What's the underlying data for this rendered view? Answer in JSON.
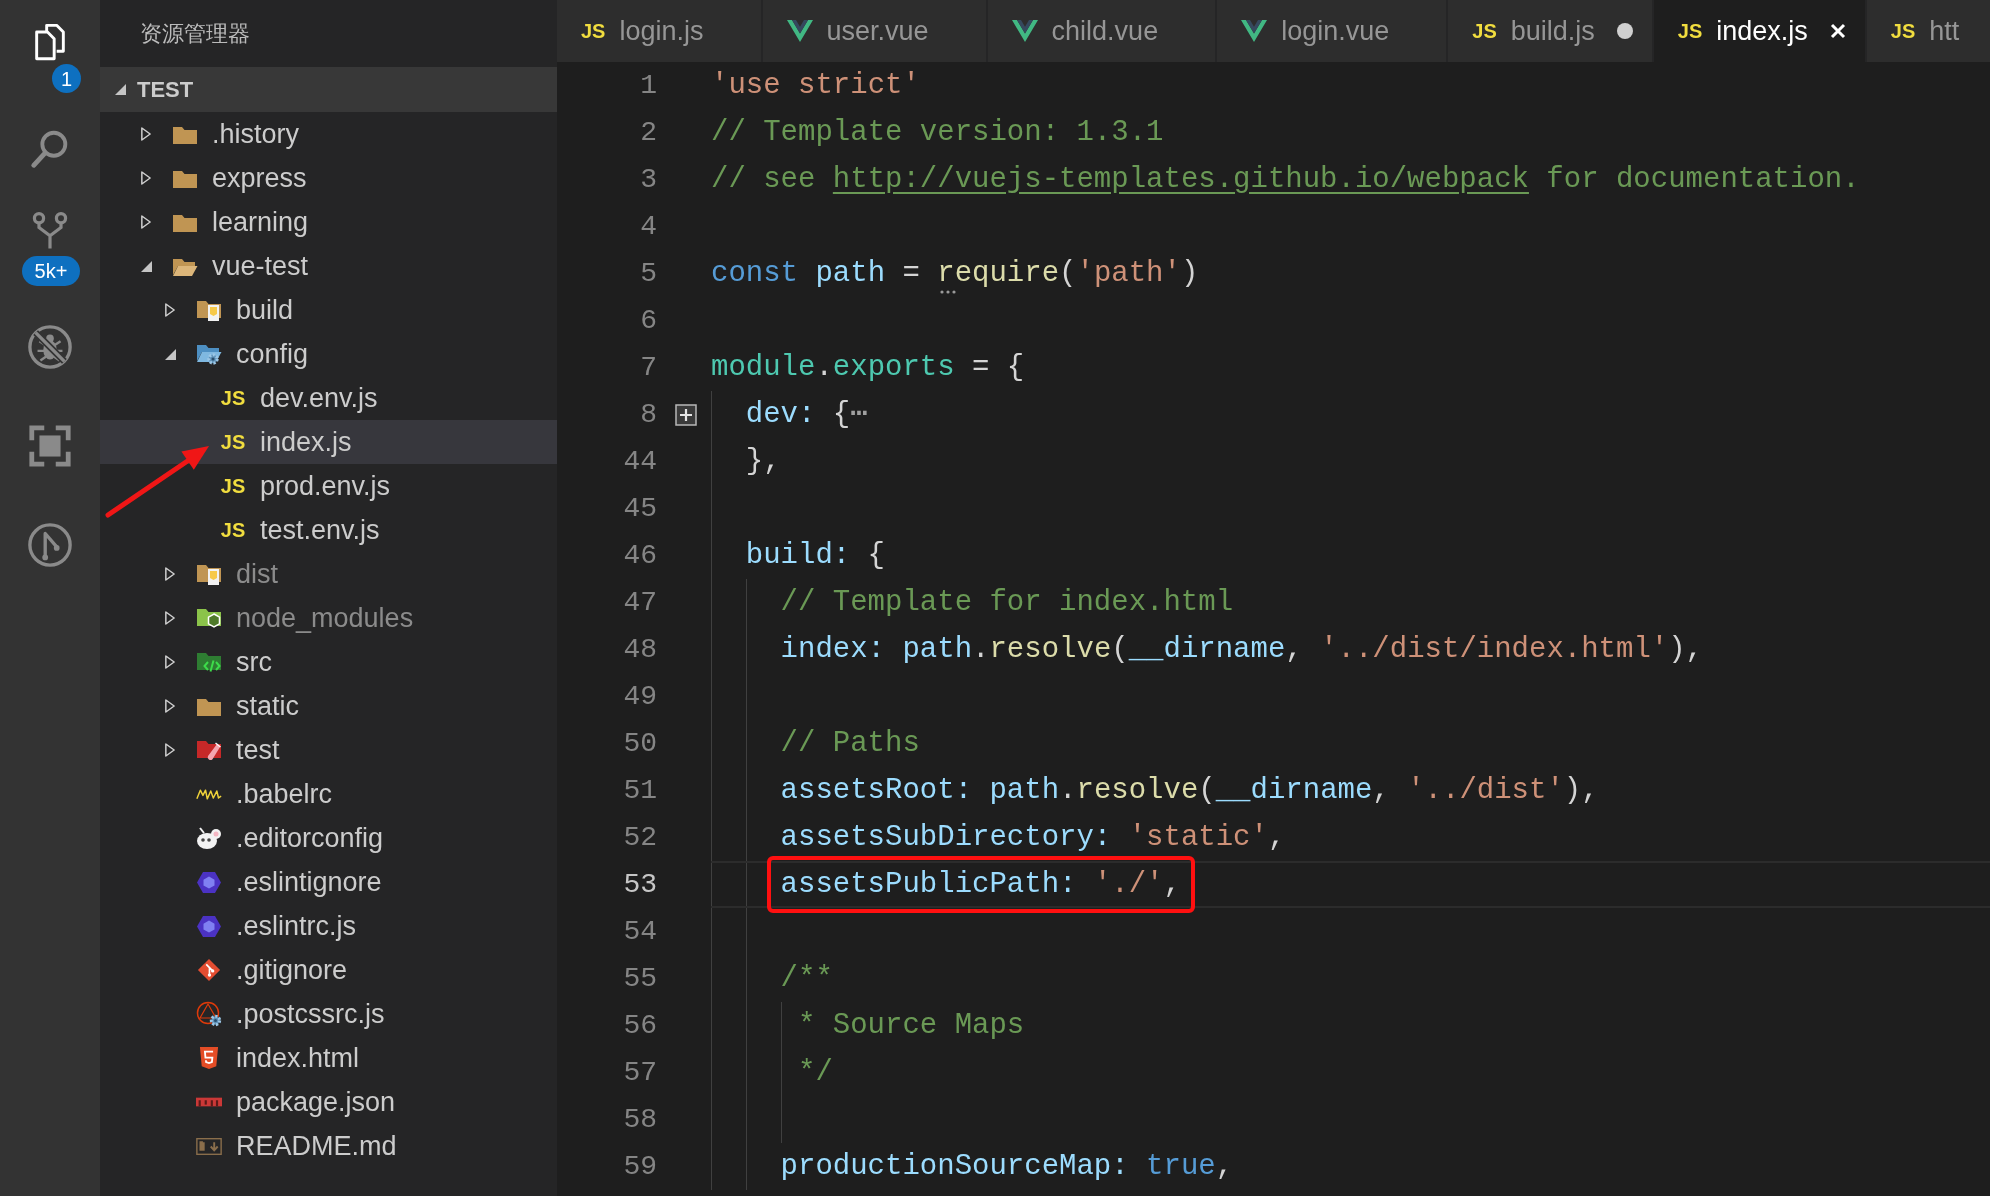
{
  "activity_bar": [
    {
      "kind": "files",
      "selected": true,
      "badge": "1"
    },
    {
      "kind": "search",
      "selected": false
    },
    {
      "kind": "scm",
      "selected": false,
      "badge": "5k+"
    },
    {
      "kind": "debug",
      "selected": false
    },
    {
      "kind": "extensions",
      "selected": false
    },
    {
      "kind": "history",
      "selected": false
    }
  ],
  "sidebar": {
    "title": "资源管理器",
    "section": {
      "label": "TEST",
      "expanded": true
    },
    "tree": [
      {
        "label": ".history",
        "kind": "folder",
        "expanded": false,
        "selected": false,
        "dimmed": false,
        "marked": false
      },
      {
        "label": "express",
        "kind": "folder",
        "expanded": false,
        "selected": false,
        "dimmed": false,
        "marked": false
      },
      {
        "label": "learning",
        "kind": "folder",
        "expanded": false,
        "selected": false,
        "dimmed": false,
        "marked": false
      },
      {
        "label": "vue-test",
        "kind": "folder",
        "expanded": true,
        "selected": false,
        "dimmed": false,
        "marked": false,
        "children": [
          {
            "label": "build",
            "kind": "buildfolder",
            "expanded": false,
            "selected": false,
            "dimmed": false,
            "marked": false
          },
          {
            "label": "config",
            "kind": "configfolder",
            "expanded": true,
            "selected": false,
            "dimmed": false,
            "marked": false,
            "children": [
              {
                "label": "dev.env.js",
                "kind": "js",
                "glyph": "JS",
                "selected": false,
                "dimmed": false,
                "marked": false
              },
              {
                "label": "index.js",
                "kind": "js",
                "glyph": "JS",
                "selected": true,
                "dimmed": false,
                "marked": true
              },
              {
                "label": "prod.env.js",
                "kind": "js",
                "glyph": "JS",
                "selected": false,
                "dimmed": false,
                "marked": false
              },
              {
                "label": "test.env.js",
                "kind": "js",
                "glyph": "JS",
                "selected": false,
                "dimmed": false,
                "marked": false
              }
            ]
          },
          {
            "label": "dist",
            "kind": "buildfolder",
            "expanded": false,
            "selected": false,
            "dimmed": true,
            "marked": false
          },
          {
            "label": "node_modules",
            "kind": "nodefolder",
            "expanded": false,
            "selected": false,
            "dimmed": true,
            "marked": false
          },
          {
            "label": "src",
            "kind": "srcfolder",
            "expanded": false,
            "selected": false,
            "dimmed": false,
            "marked": false
          },
          {
            "label": "static",
            "kind": "folder",
            "expanded": false,
            "selected": false,
            "dimmed": false,
            "marked": false
          },
          {
            "label": "test",
            "kind": "testfolder",
            "expanded": false,
            "selected": false,
            "dimmed": false,
            "marked": false
          },
          {
            "label": ".babelrc",
            "kind": "babel",
            "selected": false,
            "dimmed": false,
            "marked": false
          },
          {
            "label": ".editorconfig",
            "kind": "editorconfig",
            "selected": false,
            "dimmed": false,
            "marked": false
          },
          {
            "label": ".eslintignore",
            "kind": "eslint",
            "selected": false,
            "dimmed": false,
            "marked": false
          },
          {
            "label": ".eslintrc.js",
            "kind": "eslint",
            "selected": false,
            "dimmed": false,
            "marked": false
          },
          {
            "label": ".gitignore",
            "kind": "git",
            "selected": false,
            "dimmed": false,
            "marked": false
          },
          {
            "label": ".postcssrc.js",
            "kind": "postcss",
            "selected": false,
            "dimmed": false,
            "marked": false
          },
          {
            "label": "index.html",
            "kind": "html",
            "selected": false,
            "dimmed": false,
            "marked": false
          },
          {
            "label": "package.json",
            "kind": "npm",
            "selected": false,
            "dimmed": false,
            "marked": false
          },
          {
            "label": "README.md",
            "kind": "markdown",
            "selected": false,
            "dimmed": false,
            "marked": false
          }
        ]
      }
    ]
  },
  "tabs": [
    {
      "label": "login.js",
      "kind": "js",
      "glyph": "JS",
      "selected": false,
      "dirty": false
    },
    {
      "label": "user.vue",
      "kind": "vue",
      "selected": false,
      "dirty": false
    },
    {
      "label": "child.vue",
      "kind": "vue",
      "selected": false,
      "dirty": false
    },
    {
      "label": "login.vue",
      "kind": "vue",
      "selected": false,
      "dirty": false
    },
    {
      "label": "build.js",
      "kind": "js",
      "glyph": "JS",
      "selected": false,
      "dirty": true
    },
    {
      "label": "index.js",
      "kind": "js",
      "glyph": "JS",
      "selected": true,
      "dirty": false
    },
    {
      "label": "htt",
      "kind": "js",
      "glyph": "JS",
      "selected": false,
      "dirty": false
    }
  ],
  "editor": {
    "lines": [
      {
        "number": "1",
        "tokens": [
          {
            "kind": "str",
            "text": "'use strict'"
          }
        ],
        "current": false,
        "folded": false,
        "marked": false
      },
      {
        "number": "2",
        "tokens": [
          {
            "kind": "comment",
            "text": "// Template version: 1.3.1"
          }
        ],
        "current": false,
        "folded": false,
        "marked": false
      },
      {
        "number": "3",
        "tokens": [
          {
            "kind": "comment",
            "text": "// see "
          },
          {
            "kind": "link",
            "text": "http://vuejs-templates.github.io/webpack"
          },
          {
            "kind": "comment",
            "text": " for documentation."
          }
        ],
        "current": false,
        "folded": false,
        "marked": false
      },
      {
        "number": "4",
        "current": false,
        "folded": false
      },
      {
        "number": "5",
        "tokens": [
          {
            "kind": "keyword",
            "text": "const"
          },
          {
            "kind": "var",
            "text": " path"
          },
          {
            "kind": "plain",
            "text": " = "
          },
          {
            "kind": "func",
            "text": "require",
            "hint": true
          },
          {
            "kind": "plain",
            "text": "("
          },
          {
            "kind": "str",
            "text": "'path'"
          },
          {
            "kind": "plain",
            "text": ")"
          }
        ],
        "current": false,
        "folded": false,
        "marked": false
      },
      {
        "number": "6",
        "current": false,
        "folded": false
      },
      {
        "number": "7",
        "tokens": [
          {
            "kind": "type",
            "text": "module"
          },
          {
            "kind": "plain",
            "text": "."
          },
          {
            "kind": "type",
            "text": "exports"
          },
          {
            "kind": "plain",
            "text": " = {"
          }
        ],
        "current": false,
        "folded": false,
        "marked": false
      },
      {
        "number": "8",
        "tokens": [
          {
            "kind": "var",
            "text": "  dev:"
          },
          {
            "kind": "plain",
            "text": " {"
          },
          {
            "kind": "fold",
            "text": "⋯"
          }
        ],
        "current": false,
        "folded": true,
        "marked": false
      },
      {
        "number": "44",
        "tokens": [
          {
            "kind": "plain",
            "text": "  },"
          }
        ],
        "current": false,
        "folded": false,
        "marked": false
      },
      {
        "number": "45",
        "current": false,
        "folded": false
      },
      {
        "number": "46",
        "tokens": [
          {
            "kind": "var",
            "text": "  build:"
          },
          {
            "kind": "plain",
            "text": " {"
          }
        ],
        "current": false,
        "folded": false,
        "marked": false
      },
      {
        "number": "47",
        "tokens": [
          {
            "kind": "comment",
            "text": "    // Template for index.html"
          }
        ],
        "current": false,
        "folded": false,
        "marked": false
      },
      {
        "number": "48",
        "tokens": [
          {
            "kind": "var",
            "text": "    index: "
          },
          {
            "kind": "var",
            "text": "path"
          },
          {
            "kind": "plain",
            "text": "."
          },
          {
            "kind": "func",
            "text": "resolve"
          },
          {
            "kind": "plain",
            "text": "("
          },
          {
            "kind": "var",
            "text": "__dirname"
          },
          {
            "kind": "plain",
            "text": ", "
          },
          {
            "kind": "str",
            "text": "'../dist/index.html'"
          },
          {
            "kind": "plain",
            "text": "),"
          }
        ],
        "current": false,
        "folded": false,
        "marked": false
      },
      {
        "number": "49",
        "current": false,
        "folded": false
      },
      {
        "number": "50",
        "tokens": [
          {
            "kind": "comment",
            "text": "    // Paths"
          }
        ],
        "current": false,
        "folded": false,
        "marked": false
      },
      {
        "number": "51",
        "tokens": [
          {
            "kind": "var",
            "text": "    assetsRoot: "
          },
          {
            "kind": "var",
            "text": "path"
          },
          {
            "kind": "plain",
            "text": "."
          },
          {
            "kind": "func",
            "text": "resolve"
          },
          {
            "kind": "plain",
            "text": "("
          },
          {
            "kind": "var",
            "text": "__dirname"
          },
          {
            "kind": "plain",
            "text": ", "
          },
          {
            "kind": "str",
            "text": "'../dist'"
          },
          {
            "kind": "plain",
            "text": "),"
          }
        ],
        "current": false,
        "folded": false,
        "marked": false
      },
      {
        "number": "52",
        "tokens": [
          {
            "kind": "var",
            "text": "    assetsSubDirectory: "
          },
          {
            "kind": "str",
            "text": "'static'"
          },
          {
            "kind": "plain",
            "text": ","
          }
        ],
        "current": false,
        "folded": false,
        "marked": false
      },
      {
        "number": "53",
        "tokens": [
          {
            "kind": "var",
            "text": "    assetsPublicPath: "
          },
          {
            "kind": "str",
            "text": "'./'"
          },
          {
            "kind": "plain",
            "text": ","
          }
        ],
        "current": true,
        "folded": false,
        "marked": true
      },
      {
        "number": "54",
        "current": false,
        "folded": false
      },
      {
        "number": "55",
        "tokens": [
          {
            "kind": "comment",
            "text": "    /**"
          }
        ],
        "current": false,
        "folded": false,
        "marked": false
      },
      {
        "number": "56",
        "tokens": [
          {
            "kind": "comment",
            "text": "     * Source Maps"
          }
        ],
        "current": false,
        "folded": false,
        "marked": false
      },
      {
        "number": "57",
        "tokens": [
          {
            "kind": "comment",
            "text": "     */"
          }
        ],
        "current": false,
        "folded": false,
        "marked": false
      },
      {
        "number": "58",
        "current": false,
        "folded": false
      },
      {
        "number": "59",
        "tokens": [
          {
            "kind": "var",
            "text": "    productionSourceMap: "
          },
          {
            "kind": "keyword",
            "text": "true"
          },
          {
            "kind": "plain",
            "text": ","
          }
        ],
        "current": false,
        "folded": false,
        "marked": false
      }
    ]
  }
}
